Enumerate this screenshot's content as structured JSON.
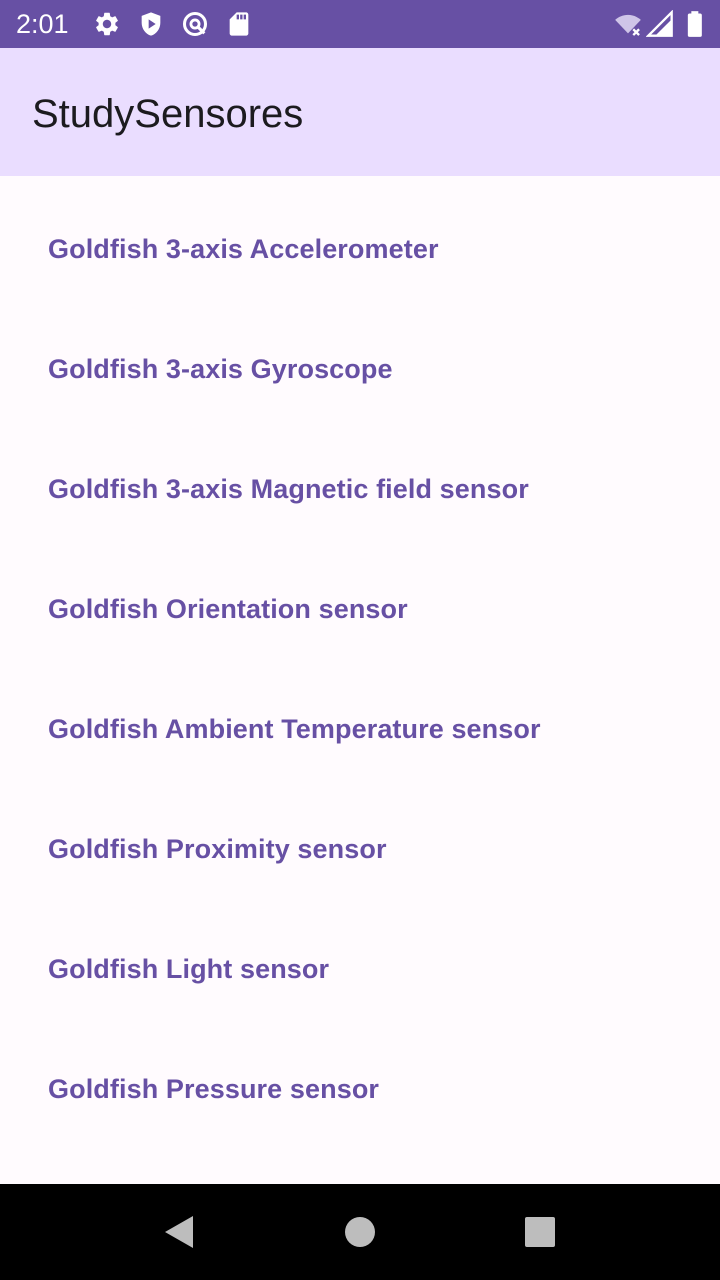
{
  "status_bar": {
    "time": "2:01",
    "background": "#6750A4",
    "left_icons": [
      "gear-icon",
      "shield-icon",
      "at-sign-icon",
      "sd-card-icon"
    ],
    "right_icons": [
      "wifi-off-icon",
      "signal-icon",
      "battery-icon"
    ]
  },
  "app_bar": {
    "title": "StudySensores",
    "background": "#EADDFF"
  },
  "sensors": [
    {
      "label": "Goldfish 3-axis Accelerometer"
    },
    {
      "label": "Goldfish 3-axis Gyroscope"
    },
    {
      "label": "Goldfish 3-axis Magnetic field sensor"
    },
    {
      "label": "Goldfish Orientation sensor"
    },
    {
      "label": "Goldfish Ambient Temperature sensor"
    },
    {
      "label": "Goldfish Proximity sensor"
    },
    {
      "label": "Goldfish Light sensor"
    },
    {
      "label": "Goldfish Pressure sensor"
    }
  ],
  "colors": {
    "accent": "#6750A4",
    "surface": "#FFFBFE",
    "on_surface": "#1C1B1F"
  },
  "nav_bar": {
    "buttons": [
      "back-icon",
      "home-icon",
      "recents-icon"
    ]
  }
}
